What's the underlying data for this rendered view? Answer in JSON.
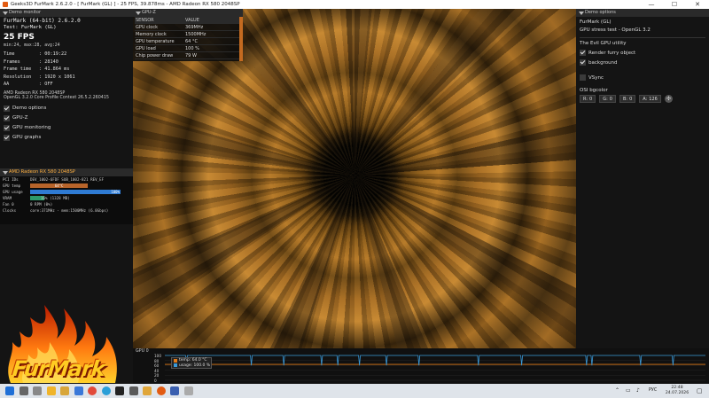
{
  "window": {
    "title": "Geeks3D FurMark 2.6.2.0 - [ FurMark (GL) ] - 25 FPS, 39.878ms - AMD Radeon RX 580 2048SP",
    "controls": [
      "—",
      "☐",
      "✕"
    ]
  },
  "demo_monitor": {
    "header": "Demo monitor",
    "app_title": "FurMark (64-bit) 2.6.2.0",
    "test": "Test: FurMark (GL)",
    "fps": "25 FPS",
    "fps_stats": "min:24, max:28, avg:24",
    "stats": [
      {
        "key": "Time",
        "value": ":  00:19:22"
      },
      {
        "key": "Frames",
        "value": ":  28140"
      },
      {
        "key": "Frame time",
        "value": ":  41.864 ms"
      },
      {
        "key": "Resolution",
        "value": ":  1920 x 1061"
      },
      {
        "key": "AA",
        "value": ":  OFF"
      }
    ],
    "renderer": "AMD Radeon RX 580 2048SP",
    "opengl": "OpenGL 3.2.0 Core Profile Context 26.5.2.260415",
    "options": [
      {
        "label": "Demo options",
        "checked": true
      },
      {
        "label": "GPU-Z",
        "checked": true
      },
      {
        "label": "GPU monitoring",
        "checked": true
      },
      {
        "label": "GPU graphs",
        "checked": true
      }
    ]
  },
  "gpu_box": {
    "header": "AMD Radeon RX 580 2048SP",
    "pci": "DEV_1002-6FDF SUB_1002-821 REV_EF",
    "gpu_temp": "64°C",
    "gpu_usage": "100%",
    "vram": "16% (1328 MB)",
    "fan": "0 RPM (0%)",
    "clocks": "core:371MHz - mem:1500MHz (6.0Gbps)",
    "labels": {
      "pci": "PCI IDs",
      "temp": "GPU temp",
      "usage": "GPU usage",
      "vram": "VRAM",
      "fan": "Fan 0",
      "clocks": "Clocks"
    },
    "temp_fraction": 0.64,
    "usage_fraction": 1.0,
    "vram_fraction": 0.16,
    "colors": {
      "temp": "#b8642a",
      "usage": "#2f7bd3",
      "vram": "#2d9a6a"
    }
  },
  "gpuz": {
    "header": "GPU-Z",
    "columns": [
      "SENSOR",
      "VALUE"
    ],
    "rows": [
      [
        "GPU clock",
        "369MHz"
      ],
      [
        "Memory clock",
        "1500MHz"
      ],
      [
        "GPU temperature",
        "64 °C"
      ],
      [
        "GPU load",
        "100 %"
      ],
      [
        "Chip power draw",
        "79 W"
      ]
    ]
  },
  "demo_options": {
    "header": "Demo options",
    "title": "FurMark (GL)",
    "subtitle": "GPU stress test - OpenGL 3.2",
    "utility": "The Evil GPU utility",
    "checks": [
      {
        "label": "Render furry object",
        "checked": true
      },
      {
        "label": "background",
        "checked": true
      },
      {
        "label": "VSync",
        "checked": false
      }
    ],
    "osi_label": "OSI bgcolor",
    "bgcolor": [
      {
        "label": "R:",
        "value": "0"
      },
      {
        "label": "G:",
        "value": "0"
      },
      {
        "label": "B:",
        "value": "0"
      },
      {
        "label": "A:",
        "value": "126"
      }
    ]
  },
  "graph": {
    "label": "GPU 0",
    "y_ticks": [
      "100",
      "80",
      "60",
      "40",
      "20",
      "0"
    ],
    "legend": [
      {
        "label": "temp: 64.0 °C",
        "color": "#e07a18"
      },
      {
        "label": "usage: 100.0 %",
        "color": "#3a9ad9"
      }
    ],
    "temp_level": 64,
    "usage_level": 100,
    "usage_dips_pct_of_width": [
      4,
      16,
      22,
      29,
      32,
      36,
      41,
      47,
      58,
      66,
      78,
      79,
      88,
      94
    ]
  },
  "taskbar": {
    "lang": "РУС",
    "time": "22:48",
    "date": "24.07.2026",
    "apps": [
      "start-icon",
      "search-icon",
      "task-view-icon",
      "explorer-icon",
      "files-icon",
      "store-icon",
      "chrome-icon",
      "telegram-icon",
      "tidal-icon",
      "photos-icon",
      "folder-icon",
      "furmark-icon",
      "gpuz-icon",
      "geeks-icon"
    ],
    "colors": {
      "start": "#1f6fd6",
      "chrome": "#e24a3a",
      "telegram": "#2a9fd8",
      "furmark": "#e25b12"
    }
  }
}
